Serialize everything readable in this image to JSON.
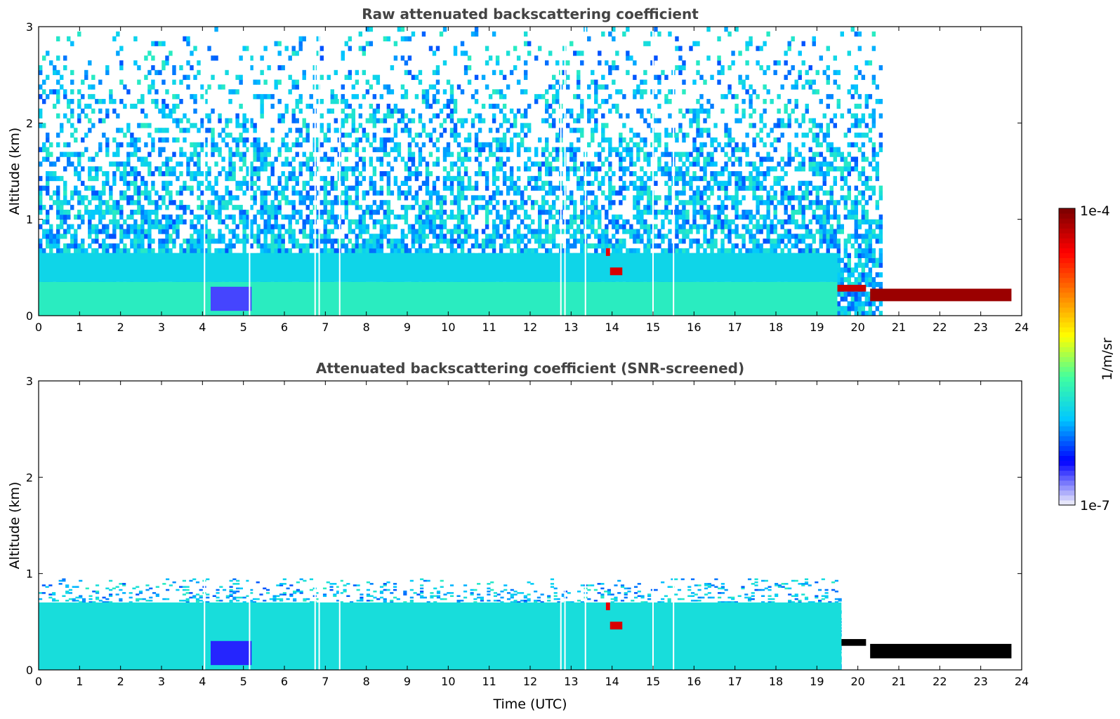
{
  "chart_data": [
    {
      "type": "heatmap",
      "title": "Raw attenuated backscattering coefficient",
      "xlabel": "",
      "ylabel": "Altitude (km)",
      "xlim": [
        0,
        24
      ],
      "ylim": [
        0,
        3
      ],
      "x_ticks": [
        "0",
        "1",
        "2",
        "3",
        "4",
        "5",
        "6",
        "7",
        "8",
        "9",
        "10",
        "11",
        "12",
        "13",
        "14",
        "15",
        "16",
        "17",
        "18",
        "19",
        "20",
        "21",
        "22",
        "23",
        "24"
      ],
      "y_ticks": [
        "0",
        "1",
        "2",
        "3"
      ],
      "grid": false,
      "noise_top_km": 3.0,
      "noise_end_hour": 20.6,
      "data_end_hour": 23.75,
      "gap_hours": [
        4.05,
        5.15,
        6.75,
        6.85,
        7.35,
        12.75,
        12.85,
        13.35,
        15.0,
        15.5
      ],
      "features": [
        {
          "x0": 0,
          "x1": 19.5,
          "y0": 0,
          "y1": 0.35,
          "level": 0.38
        },
        {
          "x0": 0,
          "x1": 19.5,
          "y0": 0.35,
          "y1": 0.65,
          "level": 0.32
        },
        {
          "x0": 4.2,
          "x1": 5.2,
          "y0": 0.05,
          "y1": 0.3,
          "level": 0.1
        },
        {
          "x0": 13.85,
          "x1": 13.95,
          "y0": 0.62,
          "y1": 0.7,
          "level": 0.88
        },
        {
          "x0": 13.95,
          "x1": 14.25,
          "y0": 0.42,
          "y1": 0.5,
          "level": 0.9
        },
        {
          "x0": 19.5,
          "x1": 20.2,
          "y0": 0.25,
          "y1": 0.32,
          "level": 0.92
        },
        {
          "x0": 20.3,
          "x1": 23.75,
          "y0": 0.15,
          "y1": 0.28,
          "level": 0.97
        }
      ]
    },
    {
      "type": "heatmap",
      "title": "Attenuated backscattering coefficient (SNR-screened)",
      "xlabel": "Time (UTC)",
      "ylabel": "Altitude (km)",
      "xlim": [
        0,
        24
      ],
      "ylim": [
        0,
        3
      ],
      "x_ticks": [
        "0",
        "1",
        "2",
        "3",
        "4",
        "5",
        "6",
        "7",
        "8",
        "9",
        "10",
        "11",
        "12",
        "13",
        "14",
        "15",
        "16",
        "17",
        "18",
        "19",
        "20",
        "21",
        "22",
        "23",
        "24"
      ],
      "y_ticks": [
        "0",
        "1",
        "2",
        "3"
      ],
      "grid": false,
      "noise_top_km": 0.95,
      "noise_end_hour": 19.6,
      "data_end_hour": 23.75,
      "gap_hours": [
        4.05,
        5.15,
        6.75,
        6.85,
        7.35,
        12.75,
        12.85,
        13.35,
        15.0,
        15.5
      ],
      "features": [
        {
          "x0": 0,
          "x1": 19.6,
          "y0": 0,
          "y1": 0.7,
          "level": 0.34
        },
        {
          "x0": 4.2,
          "x1": 5.2,
          "y0": 0.05,
          "y1": 0.3,
          "level": 0.12
        },
        {
          "x0": 13.85,
          "x1": 13.95,
          "y0": 0.62,
          "y1": 0.7,
          "level": 0.88
        },
        {
          "x0": 13.95,
          "x1": 14.25,
          "y0": 0.42,
          "y1": 0.5,
          "level": 0.9
        },
        {
          "x0": 19.6,
          "x1": 20.2,
          "y0": 0.25,
          "y1": 0.32,
          "level": 1.0
        },
        {
          "x0": 20.3,
          "x1": 23.75,
          "y0": 0.12,
          "y1": 0.27,
          "level": 1.0
        }
      ]
    }
  ],
  "colorbar": {
    "label": "1/m/sr",
    "max_label": "1e-4",
    "min_label": "1e-7",
    "scale": "log",
    "colors": [
      "#e6e6fa",
      "#0000ff",
      "#00c8ff",
      "#40ffa0",
      "#ffff00",
      "#ff8000",
      "#ff0000",
      "#800000"
    ],
    "saturation_color": "#000000"
  }
}
